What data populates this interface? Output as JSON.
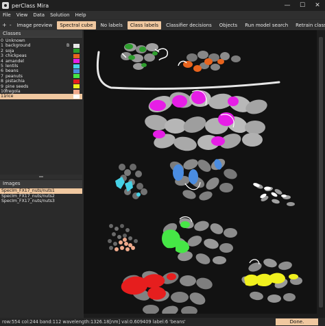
{
  "window": {
    "title": "perClass Mira",
    "minimize": "—",
    "maximize": "☐",
    "close": "✕"
  },
  "menu": [
    "File",
    "View",
    "Data",
    "Solution",
    "Help"
  ],
  "toolbar": {
    "add_icon": "+",
    "remove_icon": "-",
    "buttons": [
      {
        "label": "Image preview",
        "active": false
      },
      {
        "label": "Spectral cube",
        "active": true
      },
      {
        "label": "No labels",
        "active": false
      },
      {
        "label": "Class labels",
        "active": true
      },
      {
        "label": "Classifier decisions",
        "active": false
      },
      {
        "label": "Objects",
        "active": false
      },
      {
        "label": "Run model search",
        "active": false
      },
      {
        "label": "Retrain classifier",
        "active": false
      }
    ]
  },
  "classes_panel": {
    "title": "Classes",
    "items": [
      {
        "num": "0",
        "name": "Unknown",
        "key": "",
        "color": ""
      },
      {
        "num": "1",
        "name": "background",
        "key": "B",
        "color": "#e8e8e8"
      },
      {
        "num": "2",
        "name": "soja",
        "key": "",
        "color": "#2e9e2e"
      },
      {
        "num": "3",
        "name": "chickpeas",
        "key": "",
        "color": "#e8641e"
      },
      {
        "num": "4",
        "name": "amandel",
        "key": "",
        "color": "#e61ee6"
      },
      {
        "num": "5",
        "name": "lentils",
        "key": "",
        "color": "#46d2e6"
      },
      {
        "num": "6",
        "name": "beans",
        "key": "",
        "color": "#4a8ce0"
      },
      {
        "num": "7",
        "name": "peanuts",
        "key": "",
        "color": "#46e646"
      },
      {
        "num": "8",
        "name": "pistachia",
        "key": "",
        "color": "#e61e1e"
      },
      {
        "num": "9",
        "name": "pine seeds",
        "key": "",
        "color": "#f0f01e"
      },
      {
        "num": "10",
        "name": "fregola",
        "key": "",
        "color": "#f0aa8c"
      },
      {
        "num": "11",
        "name": "rice",
        "key": "",
        "color": "#ffffff"
      }
    ],
    "selected_index": 11
  },
  "images_panel": {
    "title": "Images",
    "items": [
      "SpecIm_FX17_nuts/nuts1",
      "SpecIm_FX17_nuts/nuts2",
      "SpecIm_FX17_nuts/nuts3"
    ],
    "selected_index": 0
  },
  "status": {
    "text": "row:554 col:244 band:112 wavelength:1326.18[nm] val:0.609409 label:6 'beans'",
    "done_label": "Done."
  },
  "colors": {
    "accent": "#f0c8a0",
    "background": "#141414"
  }
}
